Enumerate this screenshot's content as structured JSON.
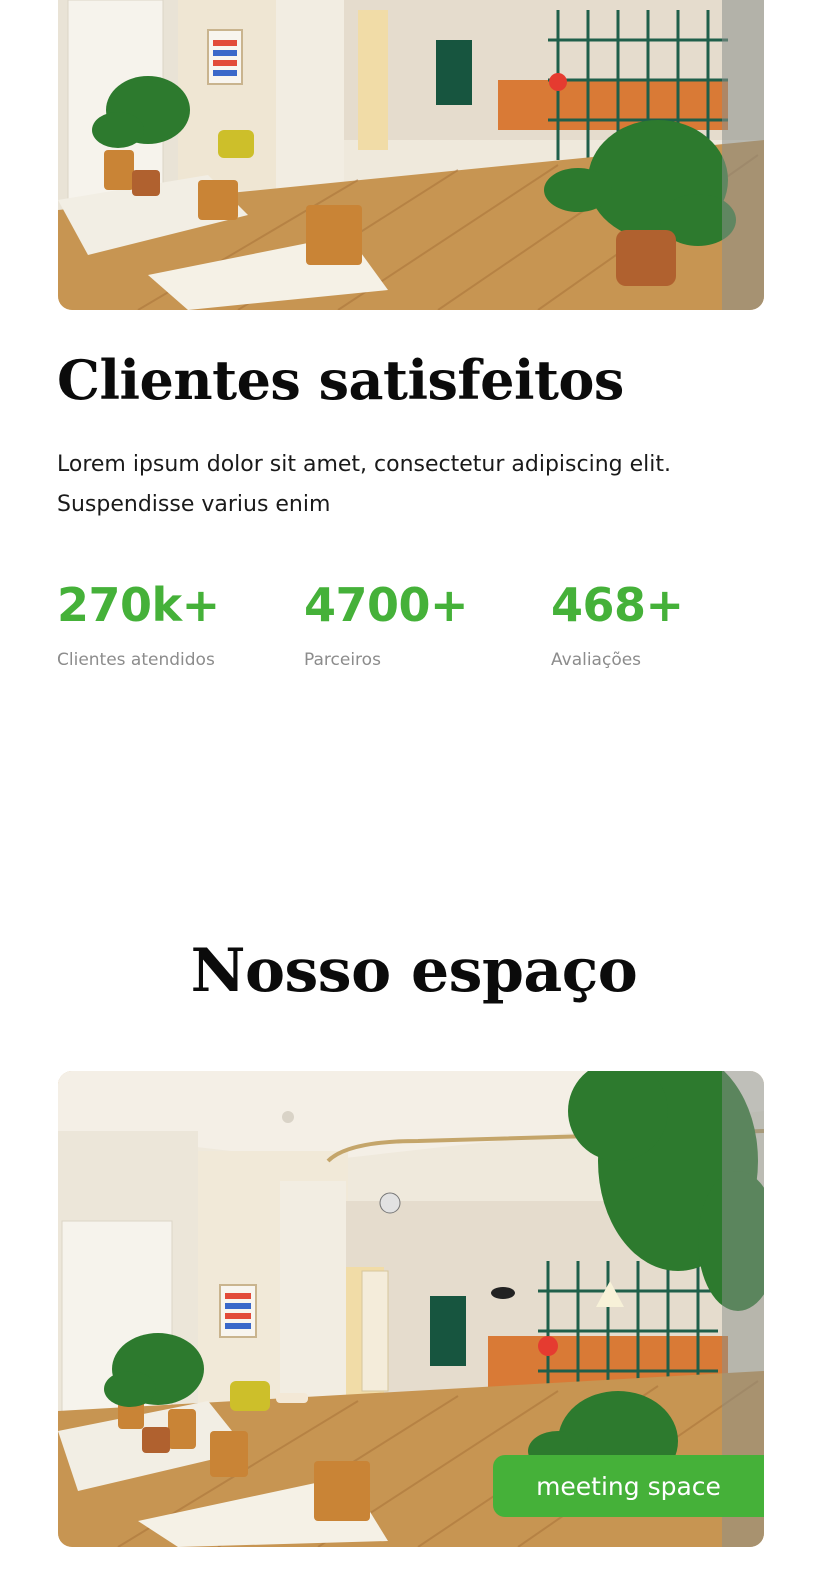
{
  "about": {
    "title": "Clientes satisfeitos",
    "description": "Lorem ipsum dolor sit amet, consectetur adipiscing elit. Suspendisse varius enim",
    "stats": [
      {
        "value": "270k+",
        "label": "Clientes atendidos"
      },
      {
        "value": "4700+",
        "label": "Parceiros"
      },
      {
        "value": "468+",
        "label": "Avaliações"
      }
    ]
  },
  "space": {
    "title": "Nosso espaço",
    "badge": "meeting space"
  },
  "colors": {
    "accent": "#45b139",
    "heading": "#0b0b0b",
    "muted": "#8c8c8c"
  }
}
